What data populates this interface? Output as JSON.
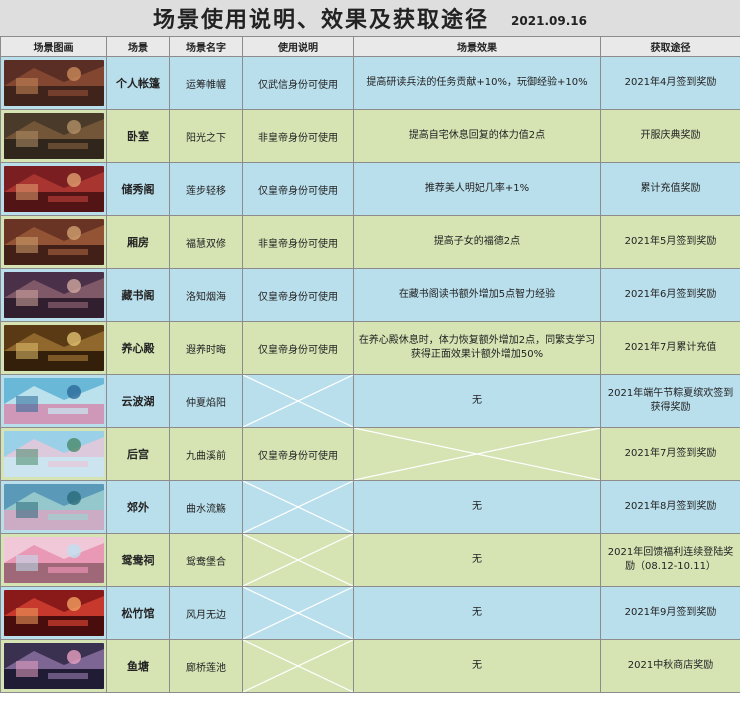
{
  "header": {
    "title": "场景使用说明、效果及获取途径",
    "date": "2021.09.16"
  },
  "columns": [
    "场景图画",
    "场景",
    "场景名字",
    "使用说明",
    "场景效果",
    "获取途径"
  ],
  "rows": [
    {
      "scene": "个人帐篷",
      "name": "运筹帷幄",
      "usage": "仅武信身份可使用",
      "effect": "提高研读兵法的任务贡献+10%，玩御经验+10%",
      "source": "2021年4月签到奖励",
      "thumb": "tent-interior",
      "color": "blue"
    },
    {
      "scene": "卧室",
      "name": "阳光之下",
      "usage": "非皇帝身份可使用",
      "effect": "提高自宅休息回复的体力值2点",
      "source": "开服庆典奖励",
      "thumb": "bedroom",
      "color": "green"
    },
    {
      "scene": "储秀阁",
      "name": "莲步轻移",
      "usage": "仅皇帝身份可使用",
      "effect": "推荐美人明妃几率+1%",
      "source": "累计充值奖励",
      "thumb": "red-hall",
      "color": "blue"
    },
    {
      "scene": "厢房",
      "name": "福慧双修",
      "usage": "非皇帝身份可使用",
      "effect": "提高子女的福德2点",
      "source": "2021年5月签到奖励",
      "thumb": "side-room",
      "color": "green"
    },
    {
      "scene": "藏书阁",
      "name": "洛知烟海",
      "usage": "仅皇帝身份可使用",
      "effect": "在藏书阁读书额外增加5点智力经验",
      "source": "2021年6月签到奖励",
      "thumb": "library",
      "color": "blue"
    },
    {
      "scene": "养心殿",
      "name": "遐养时晦",
      "usage": "仅皇帝身份可使用",
      "effect": "在养心殿休息时，体力恢复额外增加2点，同繁支学习获得正面效果计额外增加50%",
      "source": "2021年7月累计充值",
      "thumb": "palace-hall",
      "color": "green"
    },
    {
      "scene": "云波湖",
      "name": "仲夏焰阳",
      "usage": "",
      "effect": "无",
      "source": "2021年端午节粽夏缤欢签到获得奖励",
      "thumb": "dragon-boat",
      "color": "blue",
      "usage_crossed": true
    },
    {
      "scene": "后宫",
      "name": "九曲溪前",
      "usage": "仅皇帝身份可使用",
      "effect": "",
      "source": "2021年7月签到奖励",
      "thumb": "garden-pavilion",
      "color": "green",
      "effect_crossed": true
    },
    {
      "scene": "郊外",
      "name": "曲水流觞",
      "usage": "",
      "effect": "无",
      "source": "2021年8月签到奖励",
      "thumb": "outskirts",
      "color": "blue",
      "usage_crossed": true
    },
    {
      "scene": "鸳鸯祠",
      "name": "鸳鸯堡合",
      "usage": "",
      "effect": "无",
      "source": "2021年回馈福利连续登陆奖励（08.12-10.11）",
      "thumb": "blossom-shrine",
      "color": "green",
      "usage_crossed": true
    },
    {
      "scene": "松竹馆",
      "name": "风月无边",
      "usage": "",
      "effect": "无",
      "source": "2021年9月签到奖励",
      "thumb": "red-theater",
      "color": "blue",
      "usage_crossed": true
    },
    {
      "scene": "鱼塘",
      "name": "廊桥莲池",
      "usage": "",
      "effect": "无",
      "source": "2021中秋商店奖励",
      "thumb": "lotus-pond",
      "color": "green",
      "usage_crossed": true
    }
  ],
  "colors": {
    "blue_row": "#b9dfec",
    "green_row": "#d6e4b4",
    "header_bg": "#e9e9e9"
  }
}
